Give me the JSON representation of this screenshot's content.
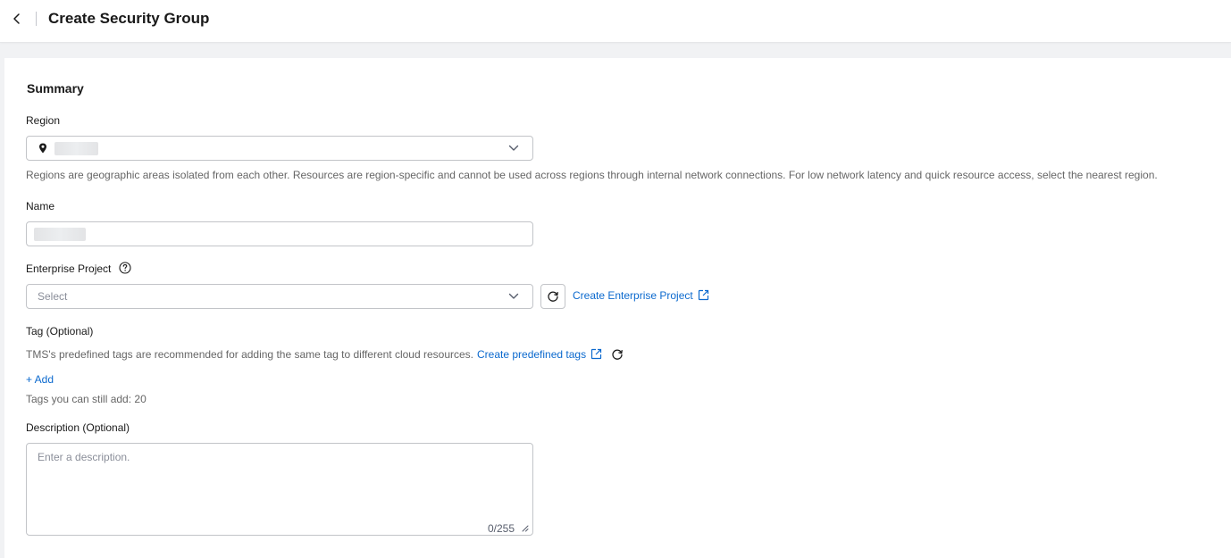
{
  "header": {
    "title": "Create Security Group",
    "back_icon": "chevron-left-icon"
  },
  "summary": {
    "title": "Summary",
    "region": {
      "label": "Region",
      "value": "",
      "hint": "Regions are geographic areas isolated from each other. Resources are region-specific and cannot be used across regions through internal network connections. For low network latency and quick resource access, select the nearest region."
    },
    "name": {
      "label": "Name",
      "value": ""
    },
    "enterprise_project": {
      "label": "Enterprise Project",
      "placeholder": "Select",
      "create_link": "Create Enterprise Project"
    },
    "tag": {
      "label": "Tag (Optional)",
      "hint": "TMS's predefined tags are recommended for adding the same tag to different cloud resources.",
      "create_link": "Create predefined tags",
      "add_label": "+ Add",
      "remaining": "Tags you can still add: 20"
    },
    "description": {
      "label": "Description (Optional)",
      "placeholder": "Enter a description.",
      "counter": "0/255"
    }
  },
  "colors": {
    "link": "#0b69ce",
    "border": "#c2c4c8",
    "page_bg": "#f1f2f4"
  }
}
